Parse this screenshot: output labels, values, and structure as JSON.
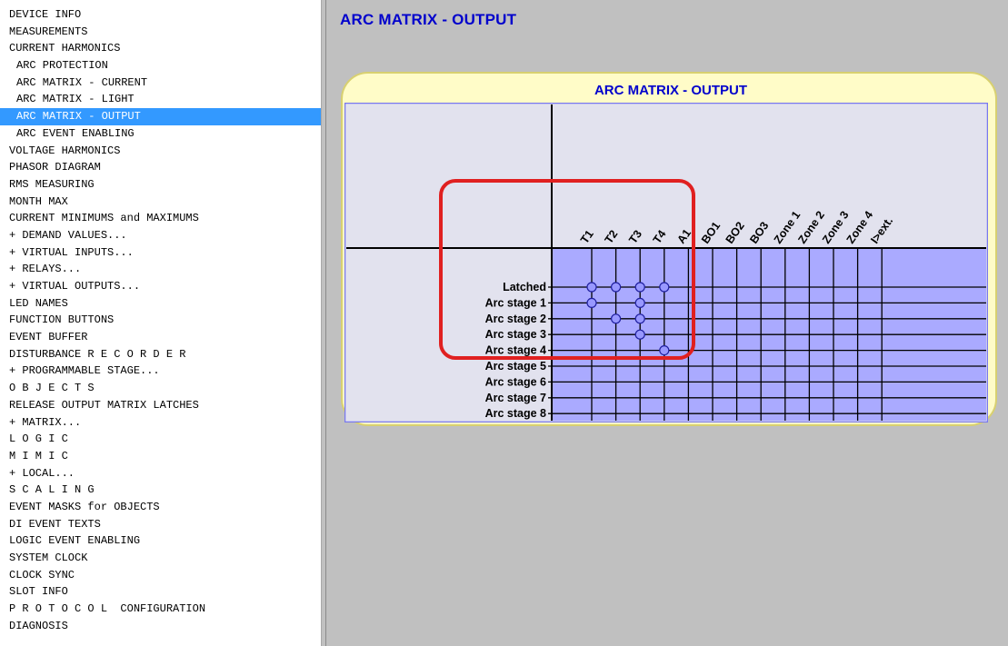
{
  "sidebar": {
    "items": [
      {
        "label": "DEVICE INFO",
        "indent": false
      },
      {
        "label": "MEASUREMENTS",
        "indent": false
      },
      {
        "label": "CURRENT HARMONICS",
        "indent": false
      },
      {
        "label": "ARC PROTECTION",
        "indent": true
      },
      {
        "label": "ARC MATRIX - CURRENT",
        "indent": true
      },
      {
        "label": "ARC MATRIX - LIGHT",
        "indent": true
      },
      {
        "label": "ARC MATRIX - OUTPUT",
        "indent": true,
        "selected": true
      },
      {
        "label": "ARC EVENT ENABLING",
        "indent": true
      },
      {
        "label": "VOLTAGE HARMONICS",
        "indent": false
      },
      {
        "label": "PHASOR DIAGRAM",
        "indent": false
      },
      {
        "label": "RMS MEASURING",
        "indent": false
      },
      {
        "label": "MONTH MAX",
        "indent": false
      },
      {
        "label": "CURRENT MINIMUMS and MAXIMUMS",
        "indent": false
      },
      {
        "label": "+ DEMAND VALUES...",
        "indent": false
      },
      {
        "label": "+ VIRTUAL INPUTS...",
        "indent": false
      },
      {
        "label": "+ RELAYS...",
        "indent": false
      },
      {
        "label": "+ VIRTUAL OUTPUTS...",
        "indent": false
      },
      {
        "label": "LED NAMES",
        "indent": false
      },
      {
        "label": "FUNCTION BUTTONS",
        "indent": false
      },
      {
        "label": "EVENT BUFFER",
        "indent": false
      },
      {
        "label": "DISTURBANCE R E C O R D E R",
        "indent": false
      },
      {
        "label": "+ PROGRAMMABLE STAGE...",
        "indent": false
      },
      {
        "label": "O B J E C T S",
        "indent": false
      },
      {
        "label": "RELEASE OUTPUT MATRIX LATCHES",
        "indent": false
      },
      {
        "label": "+ MATRIX...",
        "indent": false
      },
      {
        "label": "L O G I C",
        "indent": false
      },
      {
        "label": "M I M I C",
        "indent": false
      },
      {
        "label": "+ LOCAL...",
        "indent": false
      },
      {
        "label": "S C A L I N G",
        "indent": false
      },
      {
        "label": "EVENT MASKS for OBJECTS",
        "indent": false
      },
      {
        "label": "DI EVENT TEXTS",
        "indent": false
      },
      {
        "label": "LOGIC EVENT ENABLING",
        "indent": false
      },
      {
        "label": "SYSTEM CLOCK",
        "indent": false
      },
      {
        "label": "CLOCK SYNC",
        "indent": false
      },
      {
        "label": "SLOT INFO",
        "indent": false
      },
      {
        "label": "P R O T O C O L  CONFIGURATION",
        "indent": false
      },
      {
        "label": "DIAGNOSIS",
        "indent": false
      }
    ]
  },
  "main": {
    "title": "ARC MATRIX - OUTPUT",
    "panel_title": "ARC MATRIX - OUTPUT"
  },
  "matrix": {
    "columns": [
      "T1",
      "T2",
      "T3",
      "T4",
      "A1",
      "BO1",
      "BO2",
      "BO3",
      "Zone 1",
      "Zone 2",
      "Zone 3",
      "Zone 4",
      "I>ext."
    ],
    "rows": [
      "Latched",
      "Arc stage 1",
      "Arc stage 2",
      "Arc stage 3",
      "Arc stage 4",
      "Arc stage 5",
      "Arc stage 6",
      "Arc stage 7",
      "Arc stage 8"
    ],
    "connections": [
      [
        0,
        0
      ],
      [
        0,
        1
      ],
      [
        0,
        2
      ],
      [
        0,
        3
      ],
      [
        1,
        0
      ],
      [
        1,
        2
      ],
      [
        2,
        1
      ],
      [
        2,
        2
      ],
      [
        3,
        2
      ],
      [
        4,
        3
      ]
    ]
  },
  "colors": {
    "title_blue": "#0000cc",
    "selected_bg": "#3399ff",
    "matrix_bg": "#aaaaff",
    "matrix_area_bg": "#e2e2ee",
    "panel_bg": "#fffcc8",
    "highlight_red": "#e02020"
  }
}
